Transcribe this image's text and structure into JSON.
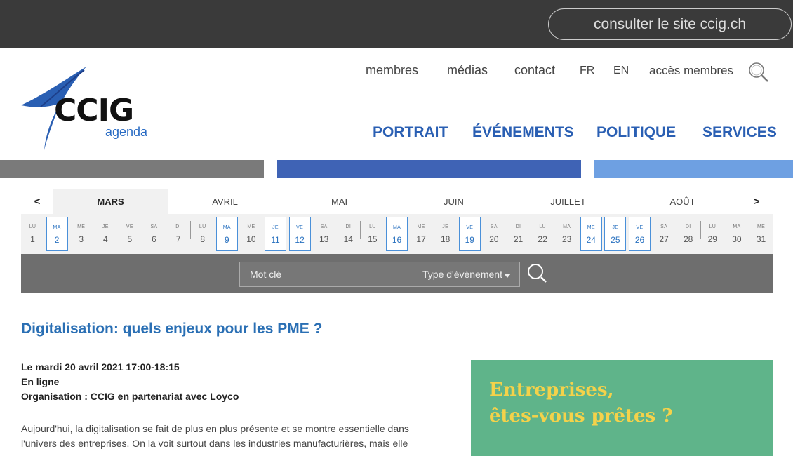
{
  "top": {
    "site_link": "consulter le site ccig.ch"
  },
  "logo": {
    "name": "CCIG",
    "sub": "agenda"
  },
  "util_nav": [
    "membres",
    "médias",
    "contact",
    "FR",
    "EN",
    "accès membres"
  ],
  "main_nav": [
    "PORTRAIT",
    "ÉVÉNEMENTS",
    "POLITIQUE",
    "SERVICES"
  ],
  "calendar": {
    "prev": "<",
    "next": ">",
    "months": [
      "MARS",
      "AVRIL",
      "MAI",
      "JUIN",
      "JUILLET",
      "AOÛT"
    ],
    "active_month": "MARS",
    "days": [
      {
        "d": "LU",
        "n": "1",
        "ev": false
      },
      {
        "d": "MA",
        "n": "2",
        "ev": true
      },
      {
        "d": "ME",
        "n": "3",
        "ev": false
      },
      {
        "d": "JE",
        "n": "4",
        "ev": false
      },
      {
        "d": "VE",
        "n": "5",
        "ev": false
      },
      {
        "d": "SA",
        "n": "6",
        "ev": false
      },
      {
        "d": "DI",
        "n": "7",
        "ev": false
      },
      {
        "d": "LU",
        "n": "8",
        "ev": false
      },
      {
        "d": "MA",
        "n": "9",
        "ev": true
      },
      {
        "d": "ME",
        "n": "10",
        "ev": false
      },
      {
        "d": "JE",
        "n": "11",
        "ev": true
      },
      {
        "d": "VE",
        "n": "12",
        "ev": true
      },
      {
        "d": "SA",
        "n": "13",
        "ev": false
      },
      {
        "d": "DI",
        "n": "14",
        "ev": false
      },
      {
        "d": "LU",
        "n": "15",
        "ev": false
      },
      {
        "d": "MA",
        "n": "16",
        "ev": true
      },
      {
        "d": "ME",
        "n": "17",
        "ev": false
      },
      {
        "d": "JE",
        "n": "18",
        "ev": false
      },
      {
        "d": "VE",
        "n": "19",
        "ev": true
      },
      {
        "d": "SA",
        "n": "20",
        "ev": false
      },
      {
        "d": "DI",
        "n": "21",
        "ev": false
      },
      {
        "d": "LU",
        "n": "22",
        "ev": false
      },
      {
        "d": "MA",
        "n": "23",
        "ev": false
      },
      {
        "d": "ME",
        "n": "24",
        "ev": true
      },
      {
        "d": "JE",
        "n": "25",
        "ev": true
      },
      {
        "d": "VE",
        "n": "26",
        "ev": true
      },
      {
        "d": "SA",
        "n": "27",
        "ev": false
      },
      {
        "d": "DI",
        "n": "28",
        "ev": false
      },
      {
        "d": "LU",
        "n": "29",
        "ev": false
      },
      {
        "d": "MA",
        "n": "30",
        "ev": false
      },
      {
        "d": "ME",
        "n": "31",
        "ev": false
      }
    ]
  },
  "search": {
    "keyword_placeholder": "Mot clé",
    "type_label": "Type d'événement"
  },
  "event": {
    "title": "Digitalisation: quels enjeux pour les PME ?",
    "date": "Le mardi 20 avril 2021 17:00-18:15",
    "location": "En ligne",
    "organisation": "Organisation : CCIG en partenariat avec Loyco",
    "body": "Aujourd'hui, la digitalisation se fait de plus en plus présente et se montre essentielle dans l'univers des entreprises. On la voit surtout dans les industries manufacturières, mais elle"
  },
  "promo": {
    "text": "Entreprises,\nêtes-vous prêtes ?"
  },
  "colors": {
    "accent": "#2a5fb3",
    "event_border": "#4a90d9",
    "promo_bg": "#5fb48a",
    "promo_text": "#f4d24a"
  }
}
